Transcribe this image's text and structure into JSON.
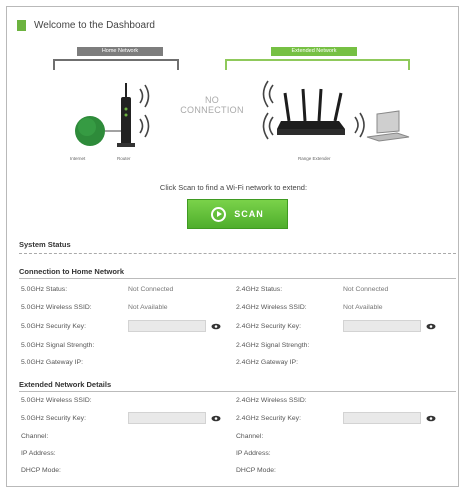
{
  "header": {
    "title": "Welcome to the Dashboard"
  },
  "diagram": {
    "home_network_label": "Home Network",
    "extended_network_label": "Extended Network",
    "no_connection": "NO CONNECTION",
    "internet_caption": "Internet",
    "router_caption": "Router",
    "extender_caption": "Range Extender"
  },
  "scan": {
    "hint": "Click Scan to find a Wi-Fi network to extend:",
    "button_label": "SCAN"
  },
  "system_status": {
    "title": "System Status",
    "home": {
      "title": "Connection to Home Network",
      "left": [
        {
          "label": "5.0GHz Status:",
          "value": "Not Connected"
        },
        {
          "label": "5.0GHz Wireless SSID:",
          "value": "Not Available"
        },
        {
          "label": "5.0GHz Security Key:",
          "value": ""
        },
        {
          "label": "5.0GHz Signal Strength:",
          "value": ""
        },
        {
          "label": "5.0GHz Gateway IP:",
          "value": ""
        }
      ],
      "right": [
        {
          "label": "2.4GHz Status:",
          "value": "Not Connected"
        },
        {
          "label": "2.4GHz Wireless SSID:",
          "value": "Not Available"
        },
        {
          "label": "2.4GHz Security Key:",
          "value": ""
        },
        {
          "label": "2.4GHz Signal Strength:",
          "value": ""
        },
        {
          "label": "2.4GHz Gateway IP:",
          "value": ""
        }
      ]
    },
    "extended": {
      "title": "Extended Network Details",
      "left": [
        {
          "label": "5.0GHz Wireless SSID:"
        },
        {
          "label": "5.0GHz Security Key:"
        },
        {
          "label": "Channel:"
        },
        {
          "label": "IP Address:"
        },
        {
          "label": "DHCP Mode:"
        }
      ],
      "right": [
        {
          "label": "2.4GHz Wireless SSID:"
        },
        {
          "label": "2.4GHz Security Key:"
        },
        {
          "label": "Channel:"
        },
        {
          "label": "IP Address:"
        },
        {
          "label": "DHCP Mode:"
        }
      ]
    }
  },
  "icons": {
    "eye": "eye-icon",
    "play": "play-icon"
  },
  "colors": {
    "accent_green": "#6cb33f",
    "button_green": "#5cbd35",
    "home_gray": "#7d7d7d"
  }
}
